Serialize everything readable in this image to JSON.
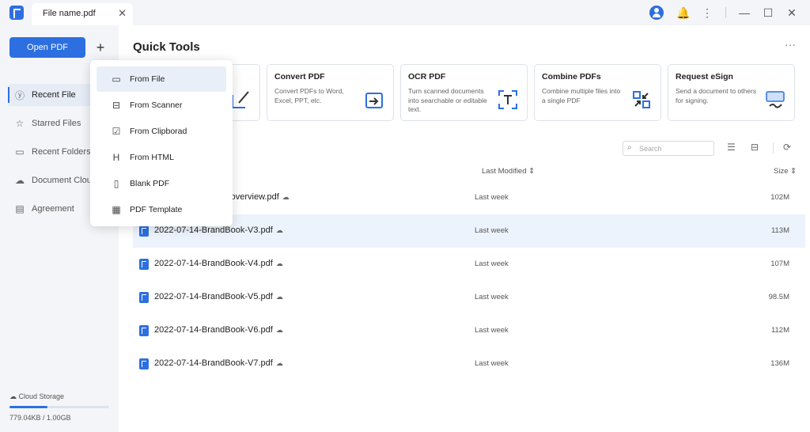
{
  "tab": {
    "label": "File name.pdf",
    "close": "✕"
  },
  "titlebar_icons": {
    "bell": "🔔",
    "menu": "⋮",
    "minimize": "—",
    "maximize": "☐",
    "close": "✕"
  },
  "sidebar": {
    "open_label": "Open PDF",
    "plus": "+",
    "items": [
      {
        "label": "Recent File",
        "icon": "ⓨ"
      },
      {
        "label": "Starred Files",
        "icon": "☆"
      },
      {
        "label": "Recent Folders",
        "icon": "▭"
      },
      {
        "label": "Document Cloud",
        "icon": "☁"
      },
      {
        "label": "Agreement",
        "icon": "▤"
      }
    ],
    "cloud_label": "Cloud Storage",
    "cloud_usage": "779.04KB / 1.00GB",
    "cloud_fraction": 0.0008
  },
  "quick_tools": {
    "title": "Quick Tools",
    "more": "···",
    "cards": [
      {
        "title": "Convert PDF",
        "desc": "Convert PDFs to Word, Excel, PPT, etc."
      },
      {
        "title": "OCR PDF",
        "desc": "Turn scanned documents into searchable or editable text."
      },
      {
        "title": "Combine PDFs",
        "desc": "Combine multiple files into a single PDF"
      },
      {
        "title": "Request eSign",
        "desc": "Send a document to others for signing."
      }
    ]
  },
  "search": {
    "placeholder": "Search",
    "icon": "⌕"
  },
  "table": {
    "col_modified": "Last Modified",
    "col_size": "Size",
    "sort_icon": "⇕",
    "rows": [
      {
        "name": "k_overview.pdf",
        "modified": "Last week",
        "size": "102M"
      },
      {
        "name": "2022-07-14-BrandBook-V3.pdf",
        "modified": "Last week",
        "size": "113M"
      },
      {
        "name": "2022-07-14-BrandBook-V4.pdf",
        "modified": "Last week",
        "size": "107M"
      },
      {
        "name": "2022-07-14-BrandBook-V5.pdf",
        "modified": "Last week",
        "size": "98.5M"
      },
      {
        "name": "2022-07-14-BrandBook-V6.pdf",
        "modified": "Last week",
        "size": "112M"
      },
      {
        "name": "2022-07-14-BrandBook-V7.pdf",
        "modified": "Last week",
        "size": "136M"
      }
    ]
  },
  "dropdown": {
    "items": [
      {
        "label": "From File",
        "icon": "▭"
      },
      {
        "label": "From Scanner",
        "icon": "⊟"
      },
      {
        "label": "From Clipborad",
        "icon": "☑"
      },
      {
        "label": "From HTML",
        "icon": "H"
      },
      {
        "label": "Blank PDF",
        "icon": "▯"
      },
      {
        "label": "PDF Template",
        "icon": "▦"
      }
    ]
  },
  "colors": {
    "accent": "#2d6fe0",
    "sidebar_bg": "#f3f5f8",
    "selected_row": "#edf3fc"
  }
}
